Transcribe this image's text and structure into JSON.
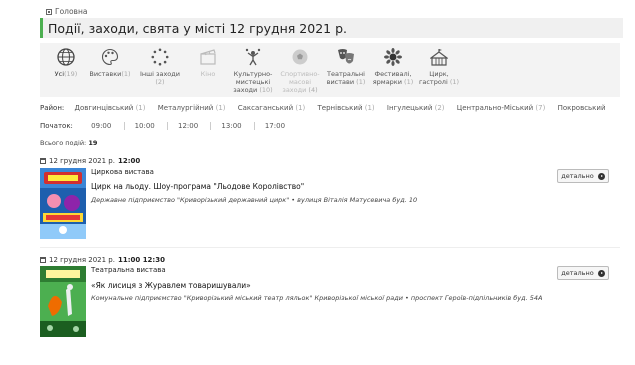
{
  "breadcrumb": {
    "home": "Головна"
  },
  "page": {
    "title": "Події, заходи, свята у місті 12 грудня 2021 р."
  },
  "categories": [
    {
      "label": "Усі",
      "count": "(19)"
    },
    {
      "label": "Виставки",
      "count": "(1)"
    },
    {
      "label": "Інші заходи",
      "count": "(2)"
    },
    {
      "label": "Кіно",
      "count": ""
    },
    {
      "label": "Культурно-мистецькі заходи",
      "count": "(10)"
    },
    {
      "label": "Спортивно-масові заходи",
      "count": "(4)"
    },
    {
      "label": "Театральні вистави",
      "count": "(1)"
    },
    {
      "label": "Фестивалі, ярмарки",
      "count": "(1)"
    },
    {
      "label": "Цирк, гастролі",
      "count": "(1)"
    }
  ],
  "districts": {
    "label": "Район:",
    "items": [
      {
        "name": "Довгинцівський",
        "count": "(1)"
      },
      {
        "name": "Металургійний",
        "count": "(1)"
      },
      {
        "name": "Саксаганський",
        "count": "(1)"
      },
      {
        "name": "Тернівський",
        "count": "(1)"
      },
      {
        "name": "Інгулецький",
        "count": "(2)"
      },
      {
        "name": "Центрально-Міський",
        "count": "(7)"
      },
      {
        "name": "Покровський",
        "count": ""
      }
    ]
  },
  "times": {
    "label": "Початок:",
    "items": [
      "09:00",
      "10:00",
      "12:00",
      "13:00",
      "17:00"
    ]
  },
  "total": {
    "label": "Всього подій:",
    "value": "19"
  },
  "events": [
    {
      "date": "12 грудня 2021 р.",
      "time": "12:00",
      "type": "Циркова вистава",
      "title": "Цирк на льоду. Шоу-програма \"Льодове Королівство\"",
      "place": "Державне підприємство \"Криворізький державний цирк\" • вулиця Віталія Матусевича буд. 10",
      "button": "детально",
      "poster_text": "ЦИРК НА ЛЬОДУ · ЛЬОДОВЕ КОРОЛІВСТВО"
    },
    {
      "date": "12 грудня 2021 р.",
      "time": "11:00 12:30",
      "type": "Театральна вистава",
      "title": "«Як лисиця з Журавлем товаришували»",
      "place": "Комунальне підприємство \"Криворізький міський театр ляльок\" Криворізької міської ради • проспект Героїв-підпільників буд. 54А",
      "button": "детально"
    }
  ],
  "colors": {
    "accent": "#4caf50",
    "title_bg": "#f0f0f0",
    "catbar_bg": "#f3f3f3"
  }
}
